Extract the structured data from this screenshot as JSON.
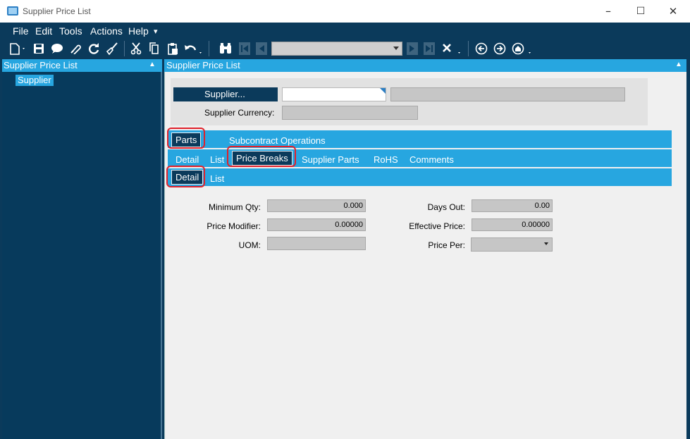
{
  "window": {
    "title": "Supplier Price List"
  },
  "menu": [
    "File",
    "Edit",
    "Tools",
    "Actions",
    "Help"
  ],
  "toolbar": {
    "icons": [
      "new-icon",
      "save-icon",
      "memo-icon",
      "attach-icon",
      "refresh-icon",
      "clear-icon",
      "cut-icon",
      "copy-icon",
      "paste-icon",
      "undo-icon",
      "search-icon",
      "first-record-icon",
      "previous-record-icon",
      "next-record-icon",
      "last-record-icon",
      "delete-icon",
      "back-icon",
      "forward-icon",
      "home-icon"
    ],
    "record_value": ""
  },
  "left_panel": {
    "title": "Supplier Price List",
    "tree": [
      "Supplier"
    ]
  },
  "right_panel": {
    "title": "Supplier Price List"
  },
  "supplier_header": {
    "supplier_button": "Supplier...",
    "supplier_id": "",
    "supplier_name": "",
    "currency_label": "Supplier Currency:",
    "currency_value": ""
  },
  "tabs": {
    "level1": [
      "Parts",
      "Subcontract Operations"
    ],
    "level1_active": "Parts",
    "level2": [
      "Detail",
      "List",
      "Price Breaks",
      "Supplier Parts",
      "RoHS",
      "Comments"
    ],
    "level2_active": "Price Breaks",
    "level3": [
      "Detail",
      "List"
    ],
    "level3_active": "Detail"
  },
  "price_break": {
    "minimum_qty_label": "Minimum Qty:",
    "minimum_qty": "0.000",
    "price_modifier_label": "Price Modifier:",
    "price_modifier": "0.00000",
    "uom_label": "UOM:",
    "uom": "",
    "days_out_label": "Days Out:",
    "days_out": "0.00",
    "effective_price_label": "Effective Price:",
    "effective_price": "0.00000",
    "price_per_label": "Price Per:",
    "price_per": ""
  },
  "colors": {
    "frame": "#0b3a5b",
    "accent": "#27a6e0",
    "highlight_circle": "#e0202a"
  }
}
